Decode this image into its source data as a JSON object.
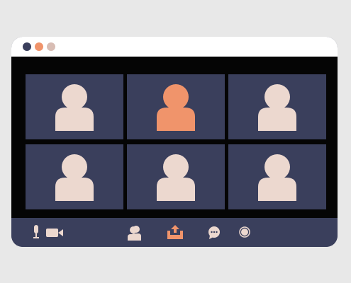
{
  "window": {
    "controls": [
      "close",
      "minimize",
      "maximize"
    ]
  },
  "participants": [
    {
      "icon": "person-icon",
      "active": false
    },
    {
      "icon": "person-icon",
      "active": true
    },
    {
      "icon": "person-icon",
      "active": false
    },
    {
      "icon": "person-icon",
      "active": false
    },
    {
      "icon": "person-icon",
      "active": false
    },
    {
      "icon": "person-icon",
      "active": false
    }
  ],
  "toolbar": {
    "items": [
      "microphone-icon",
      "camera-icon",
      "participants-icon",
      "share-screen-icon",
      "chat-icon",
      "record-icon"
    ]
  },
  "colors": {
    "page_background": "#e8e8e8",
    "window_frame": "#3a3f5c",
    "stage_background": "#050505",
    "avatar_default": "#ecd8cf",
    "avatar_active": "#f0946b",
    "dot_dark": "#3a3f5c",
    "dot_orange": "#f0946b",
    "dot_pink": "#d8bdb4"
  }
}
